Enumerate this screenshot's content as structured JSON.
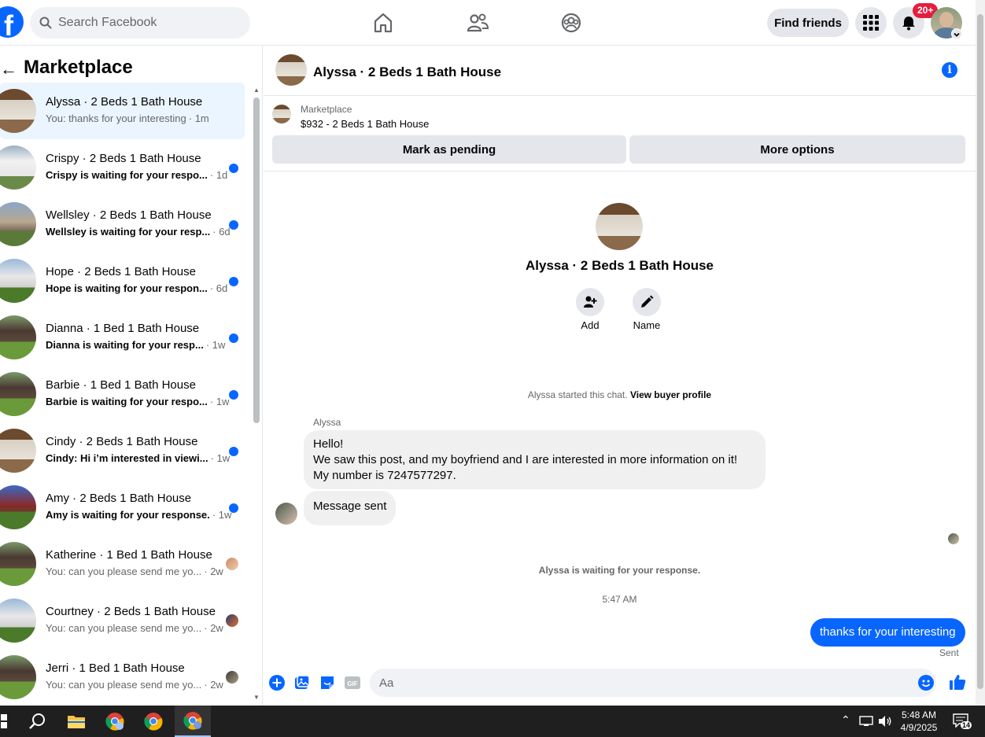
{
  "topbar": {
    "logo": "f",
    "search_placeholder": "Search Facebook",
    "nav_icons": [
      "home-icon",
      "friends-icon",
      "groups-icon"
    ],
    "find_friends": "Find friends",
    "notifications_badge": "20+"
  },
  "sidebar": {
    "title": "Marketplace",
    "conversations": [
      {
        "name": "Alyssa · 2 Beds 1 Bath House",
        "preview": "You: thanks for your interesting",
        "time": "· 1m",
        "unread": false,
        "active": true,
        "indicator": "none"
      },
      {
        "name": "Crispy · 2 Beds 1 Bath House",
        "preview": "Crispy is waiting for your respo...",
        "time": "· 1d",
        "unread": true,
        "indicator": "dot"
      },
      {
        "name": "Wellsley · 2 Beds 1 Bath House",
        "preview": "Wellsley is waiting for your resp...",
        "time": "· 6d",
        "unread": true,
        "indicator": "dot"
      },
      {
        "name": "Hope · 2 Beds 1 Bath House",
        "preview": "Hope is waiting for your respon...",
        "time": "· 6d",
        "unread": true,
        "indicator": "dot"
      },
      {
        "name": "Dianna · 1 Bed 1 Bath House",
        "preview": "Dianna is waiting for your resp...",
        "time": "· 1w",
        "unread": true,
        "indicator": "dot"
      },
      {
        "name": "Barbie · 1 Bed 1 Bath House",
        "preview": "Barbie is waiting for your respo...",
        "time": "· 1w",
        "unread": true,
        "indicator": "dot"
      },
      {
        "name": "Cindy · 2 Beds 1 Bath House",
        "preview": "Cindy: Hi i’m interested in viewi...",
        "time": "· 1w",
        "unread": true,
        "indicator": "dot"
      },
      {
        "name": "Amy · 2 Beds 1 Bath House",
        "preview": "Amy is waiting for your response.",
        "time": "· 1w",
        "unread": true,
        "indicator": "dot"
      },
      {
        "name": "Katherine · 1 Bed 1 Bath House",
        "preview": "You: can you please send me yo...",
        "time": "· 2w",
        "unread": false,
        "indicator": "avatar"
      },
      {
        "name": "Courtney · 2 Beds 1 Bath House",
        "preview": "You: can you please send me yo...",
        "time": "· 2w",
        "unread": false,
        "indicator": "avatar"
      },
      {
        "name": "Jerri · 1 Bed 1 Bath House",
        "preview": "You: can you please send me yo...",
        "time": "· 2w",
        "unread": false,
        "indicator": "avatar"
      }
    ]
  },
  "chat": {
    "title": "Alyssa · 2 Beds 1 Bath House",
    "listing_label": "Marketplace",
    "listing_price": "$932 - 2 Beds 1 Bath House",
    "mark_pending": "Mark as pending",
    "more_options": "More options",
    "profile_name": "Alyssa · 2 Beds 1 Bath House",
    "add_label": "Add",
    "name_label": "Name",
    "started_text": "Alyssa started this chat.",
    "view_buyer": "View buyer profile",
    "sender": "Alyssa",
    "msg_line1": "Hello!",
    "msg_line2": "We saw this post, and my boyfriend and I are interested in more information on it!",
    "msg_line3": "My number is 7247577297.",
    "msg_sent": "Message sent",
    "waiting_text": "Alyssa is waiting for your response.",
    "timestamp": "5:47 AM",
    "outgoing": "thanks for your interesting",
    "sent_status": "Sent",
    "composer_placeholder": "Aa"
  },
  "taskbar": {
    "time": "5:48 AM",
    "date": "4/9/2025",
    "notification_count": "14"
  },
  "colors": {
    "accent": "#0866ff",
    "bubble_gray": "#f0f0f0",
    "badge_red": "#e41e3f"
  }
}
